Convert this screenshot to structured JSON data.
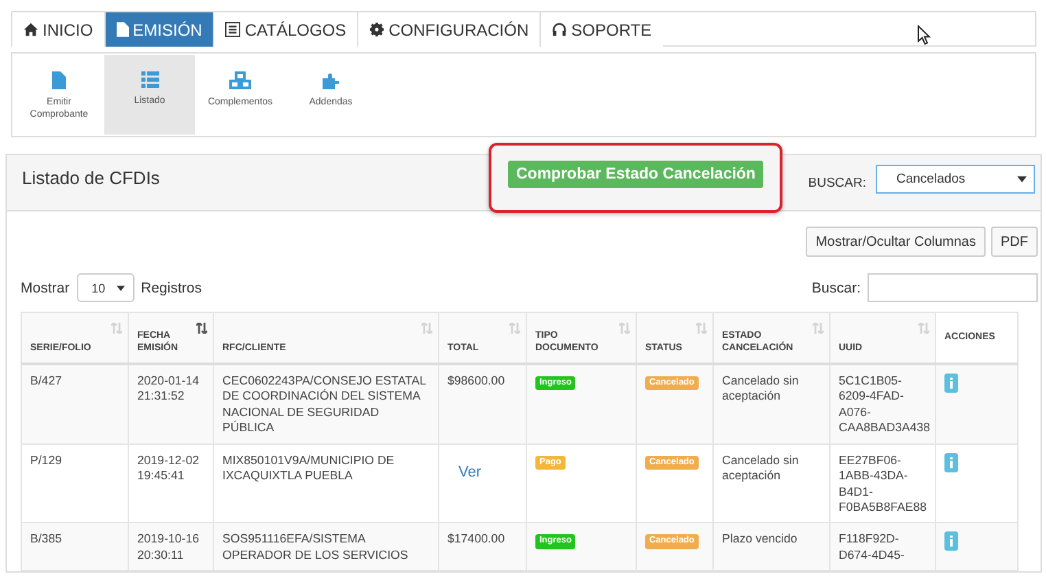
{
  "nav_tabs": [
    {
      "label": "INICIO",
      "selected": false
    },
    {
      "label": "EMISIÓN",
      "selected": true
    },
    {
      "label": "CATÁLOGOS",
      "selected": false
    },
    {
      "label": "CONFIGURACIÓN",
      "selected": false
    },
    {
      "label": "SOPORTE",
      "selected": false
    }
  ],
  "submenu": [
    {
      "label": "Emitir Comprobante",
      "selected": false
    },
    {
      "label": "Listado",
      "selected": true
    },
    {
      "label": "Complementos",
      "selected": false
    },
    {
      "label": "Addendas",
      "selected": false
    }
  ],
  "panel": {
    "title": "Listado de CFDIs",
    "check_button": "Comprobar Estado Cancelación",
    "search_label": "BUSCAR:",
    "search_select": "Cancelados"
  },
  "toolbar": {
    "buttons": [
      "Mostrar/Ocultar Columnas",
      "PDF"
    ],
    "show_label": "Mostrar",
    "page_size": "10",
    "records_label": "Registros",
    "search_label": "Buscar:"
  },
  "table": {
    "columns": [
      {
        "label": "SERIE/FOLIO",
        "sortable": true,
        "sorted": false
      },
      {
        "label": "FECHA EMISIÓN",
        "sortable": true,
        "sorted": true
      },
      {
        "label": "RFC/CLIENTE",
        "sortable": true,
        "sorted": false
      },
      {
        "label": "TOTAL",
        "sortable": true,
        "sorted": false
      },
      {
        "label": "TIPO DOCUMENTO",
        "sortable": true,
        "sorted": false
      },
      {
        "label": "STATUS",
        "sortable": true,
        "sorted": false
      },
      {
        "label": "ESTADO CANCELACIÓN",
        "sortable": true,
        "sorted": false
      },
      {
        "label": "UUID",
        "sortable": true,
        "sorted": false
      },
      {
        "label": "ACCIONES",
        "sortable": false
      }
    ],
    "rows": [
      {
        "serie": "B/427",
        "fecha": "2020-01-14 21:31:52",
        "cliente": "CEC0602243PA/CONSEJO ESTATAL DE COORDINACIÓN DEL SISTEMA NACIONAL DE SEGURIDAD PÚBLICA",
        "total": {
          "kind": "amount",
          "text": "$98600.00"
        },
        "tipo": {
          "label": "Ingreso",
          "color": "#22c41e"
        },
        "status": {
          "label": "Cancelado",
          "color": "#f0ad4e"
        },
        "estado": "Cancelado sin aceptación",
        "uuid": "5C1C1B05-6209-4FAD-A076-CAA8BAD3A438"
      },
      {
        "serie": "P/129",
        "fecha": "2019-12-02 19:45:41",
        "cliente": "MIX850101V9A/MUNICIPIO DE IXCAQUIXTLA PUEBLA",
        "total": {
          "kind": "link",
          "text": "Ver"
        },
        "tipo": {
          "label": "Pago",
          "color": "#f5b73b"
        },
        "status": {
          "label": "Cancelado",
          "color": "#f0ad4e"
        },
        "estado": "Cancelado sin aceptación",
        "uuid": "EE27BF06-1ABB-43DA-B4D1-F0BA5B8FAE88"
      },
      {
        "serie": "B/385",
        "fecha": "2019-10-16 20:30:11",
        "cliente": "SOS951116EFA/SISTEMA OPERADOR DE LOS SERVICIOS",
        "total": {
          "kind": "amount",
          "text": "$17400.00"
        },
        "tipo": {
          "label": "Ingreso",
          "color": "#22c41e"
        },
        "status": {
          "label": "Cancelado",
          "color": "#f0ad4e"
        },
        "estado": "Plazo vencido",
        "uuid": "F118F92D-D674-4D45-"
      }
    ]
  }
}
